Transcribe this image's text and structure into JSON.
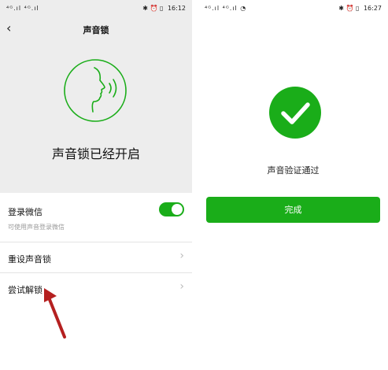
{
  "left": {
    "status": {
      "carrier": "⁴ᴳ.ıl ⁴ᴳ.ıl",
      "time": "16:12"
    },
    "nav": {
      "title": "声音锁",
      "back": "‹"
    },
    "main_status": "声音锁已经开启",
    "login_row": {
      "label": "登录微信",
      "sub": "可使用声音登录微信",
      "toggle_on": true
    },
    "reset_row": {
      "label": "重设声音锁"
    },
    "try_row": {
      "label": "尝试解锁"
    },
    "accent": "#1aad19"
  },
  "right": {
    "status": {
      "carrier": "⁴ᴳ.ıl ⁴ᴳ.ıl ◔",
      "time": "16:27"
    },
    "verify_text": "声音验证通过",
    "done_button": "完成"
  },
  "icons": [
    "voice-face-icon",
    "check-icon",
    "chevron-right-icon",
    "back-arrow-icon",
    "annotation-arrow"
  ]
}
